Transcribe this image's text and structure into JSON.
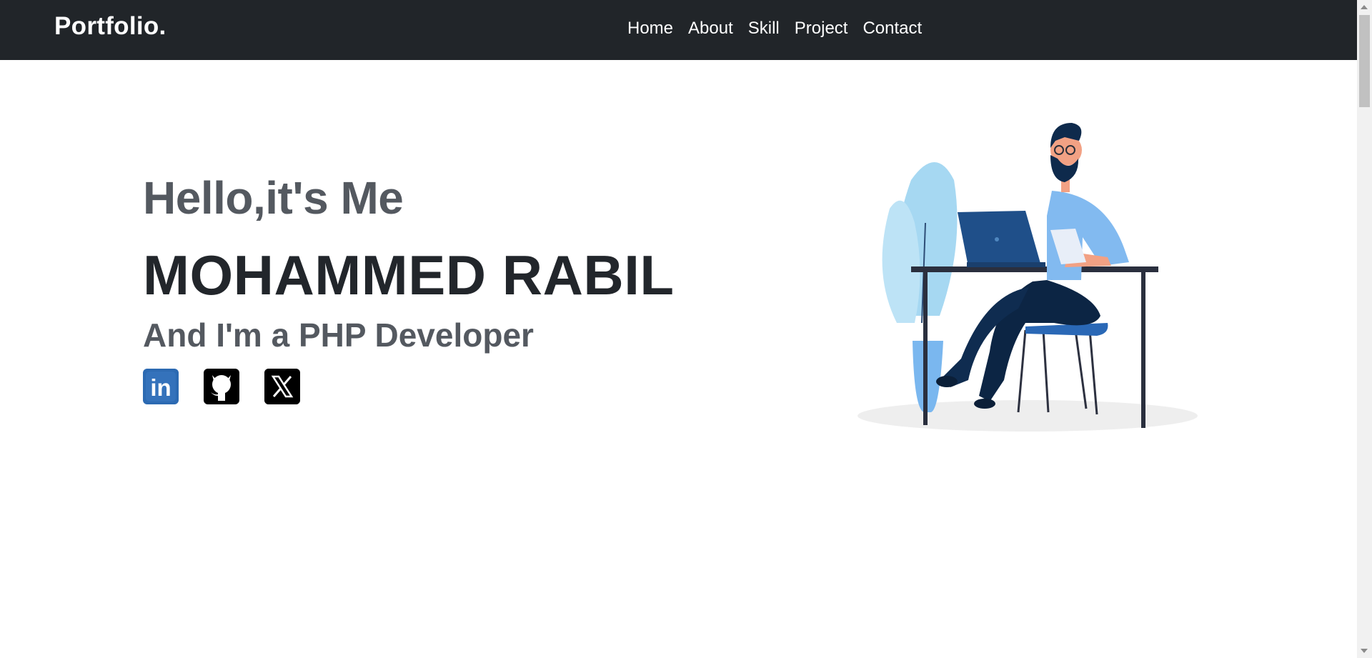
{
  "navbar": {
    "brand": "Portfolio.",
    "links": [
      "Home",
      "About",
      "Skill",
      "Project",
      "Contact"
    ]
  },
  "hero": {
    "greeting": "Hello,it's Me",
    "name": "MOHAMMED RABIL",
    "role": "And I'm a PHP Developer"
  },
  "socials": [
    {
      "icon": "linkedin-icon",
      "label": "in"
    },
    {
      "icon": "github-icon"
    },
    {
      "icon": "x-icon"
    }
  ],
  "colors": {
    "navbar_bg": "#212529",
    "accent_blue": "#2c6ab2"
  }
}
